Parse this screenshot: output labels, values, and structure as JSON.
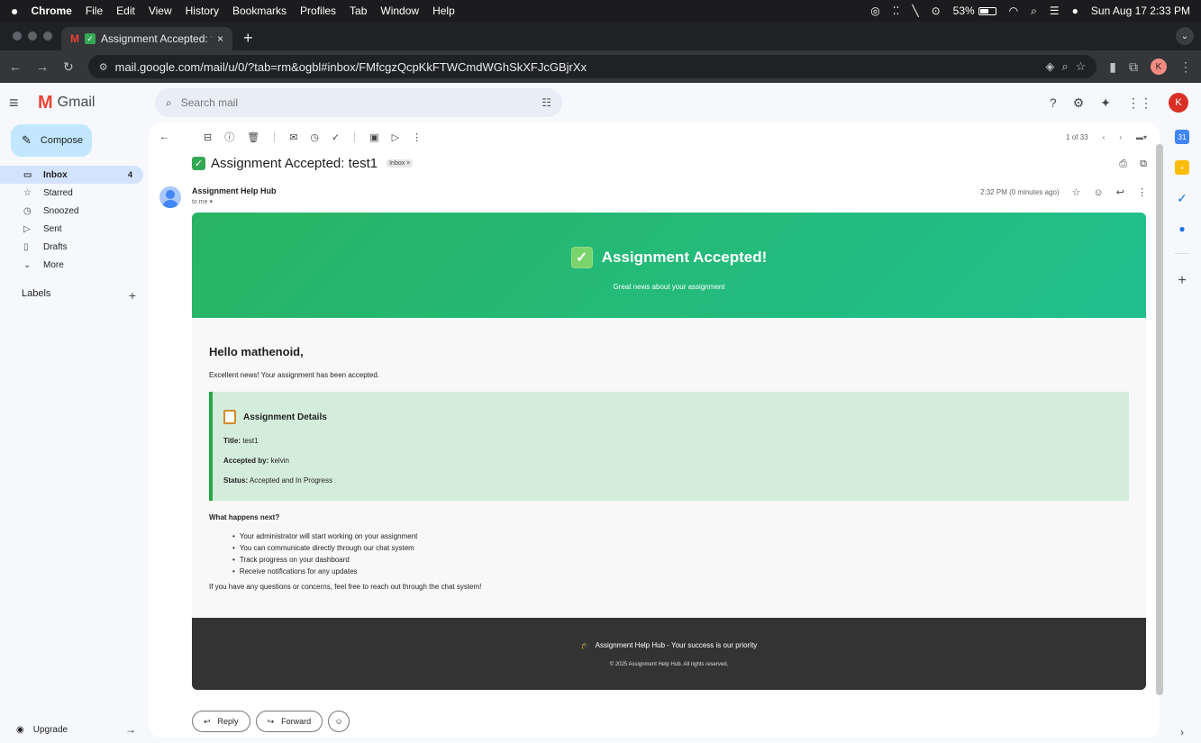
{
  "menubar": {
    "apple": "",
    "items": [
      "Chrome",
      "File",
      "Edit",
      "View",
      "History",
      "Bookmarks",
      "Profiles",
      "Tab",
      "Window",
      "Help"
    ],
    "battery": "53%",
    "datetime": "Sun Aug 17  2:33 PM"
  },
  "browser": {
    "tab_title": "Assignment Accepted: te",
    "url": "mail.google.com/mail/u/0/?tab=rm&ogbl#inbox/FMfcgzQcpKkFTWCmdWGhSkXFJcGBjrXx",
    "profile_initial": "K"
  },
  "gmail": {
    "logo_text": "Gmail",
    "search_placeholder": "Search mail",
    "account_initial": "K",
    "compose_label": "Compose",
    "nav": [
      {
        "label": "Inbox",
        "count": "4",
        "icon": "inbox-icon"
      },
      {
        "label": "Starred",
        "count": "",
        "icon": "star-icon"
      },
      {
        "label": "Snoozed",
        "count": "",
        "icon": "clock-icon"
      },
      {
        "label": "Sent",
        "count": "",
        "icon": "send-icon"
      },
      {
        "label": "Drafts",
        "count": "",
        "icon": "draft-icon"
      },
      {
        "label": "More",
        "count": "",
        "icon": "chevron-down-icon"
      }
    ],
    "labels_title": "Labels",
    "upgrade_label": "Upgrade",
    "pager_text": "1 of 33"
  },
  "message": {
    "subject": "Assignment Accepted: test1",
    "inbox_badge": "Inbox ×",
    "sender_name": "Assignment Help Hub",
    "recipient": "to me ▾",
    "time": "2:32 PM (0 minutes ago)"
  },
  "email": {
    "hero_title": "Assignment Accepted!",
    "hero_subtitle": "Great news about your assignment",
    "greeting": "Hello mathenoid,",
    "intro": "Excellent news! Your assignment has been accepted.",
    "details_title": "Assignment Details",
    "title_label": "Title:",
    "title_value": "test1",
    "accepted_label": "Accepted by:",
    "accepted_value": "kelvin",
    "status_label": "Status:",
    "status_value": "Accepted and In Progress",
    "next_title": "What happens next?",
    "next_items": [
      "Your administrator will start working on your assignment",
      "You can communicate directly through our chat system",
      "Track progress on your dashboard",
      "Receive notifications for any updates"
    ],
    "closing": "If you have any questions or concerns, feel free to reach out through the chat system!",
    "footer_line1": "Assignment Help Hub - Your success is our priority",
    "footer_line2": "© 2025 Assignment Help Hub. All rights reserved."
  },
  "actions": {
    "reply": "Reply",
    "forward": "Forward"
  },
  "colors": {
    "hero_gradient_start": "#28b463",
    "hero_gradient_end": "#20c08e",
    "details_bg": "#d4edda",
    "details_border": "#28a745",
    "footer_bg": "#333333",
    "compose_bg": "#c2e7ff",
    "nav_active_bg": "#d3e3fd"
  }
}
